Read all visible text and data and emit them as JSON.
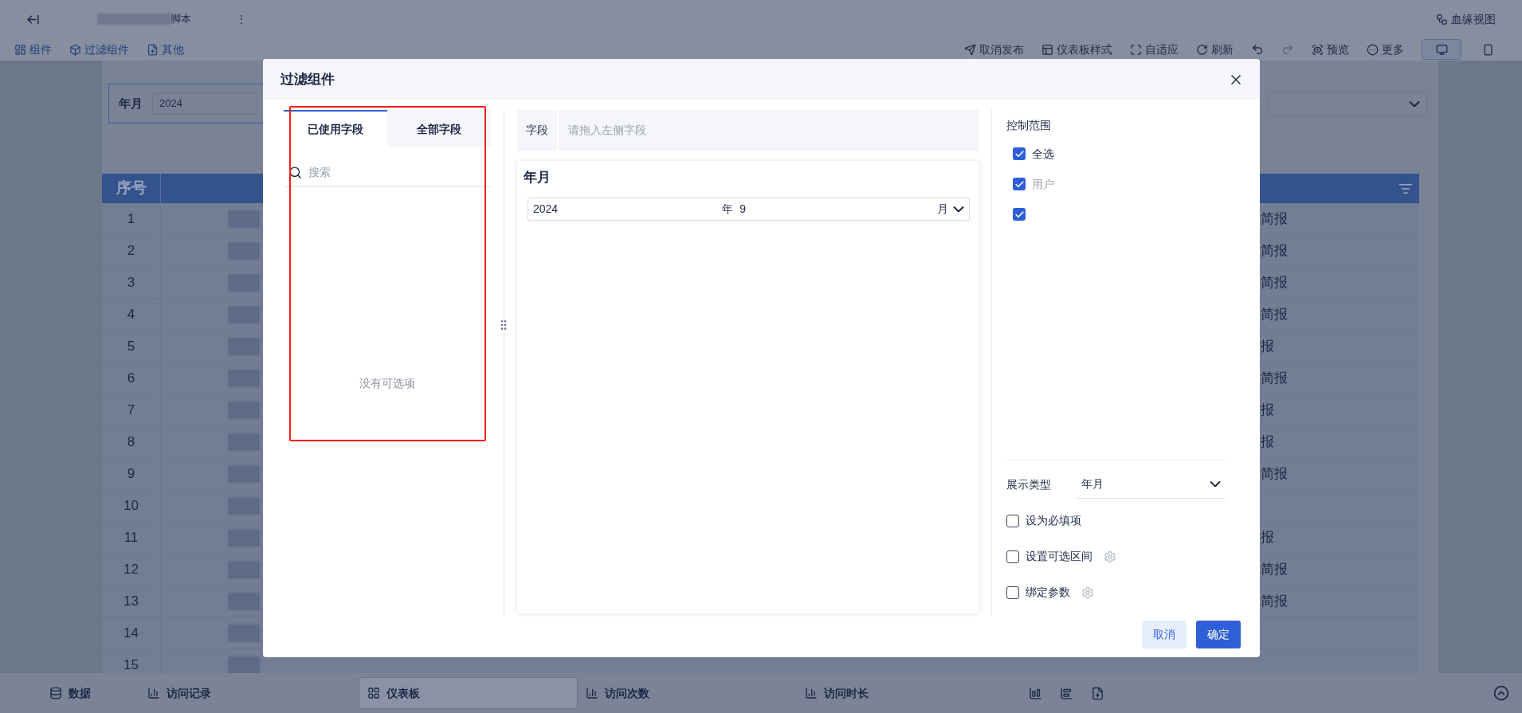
{
  "top_bar": {
    "title_tail": "脚本",
    "more": "⋮",
    "lineage": "血缘视图"
  },
  "toolbar": {
    "left": [
      {
        "kind": "component",
        "label": "组件"
      },
      {
        "kind": "filter",
        "label": "过滤组件"
      },
      {
        "kind": "other",
        "label": "其他"
      }
    ],
    "right": [
      {
        "kind": "unpublish",
        "label": "取消发布"
      },
      {
        "kind": "style",
        "label": "仪表板样式"
      },
      {
        "kind": "fit",
        "label": "自适应"
      },
      {
        "kind": "refresh",
        "label": "刷新"
      }
    ],
    "preview": "预览",
    "more": "更多",
    "devices": [
      {
        "kind": "desktop",
        "selected": true
      },
      {
        "kind": "mobile",
        "selected": false
      }
    ]
  },
  "canvas_filter": {
    "label": "年月",
    "value": "2024"
  },
  "table": {
    "columns": [
      "序号"
    ],
    "rows": [
      {
        "index": "1",
        "tail": "简报"
      },
      {
        "index": "2",
        "tail": "简报"
      },
      {
        "index": "3",
        "tail": "简报"
      },
      {
        "index": "4",
        "tail": "简报"
      },
      {
        "index": "5",
        "tail": "报"
      },
      {
        "index": "6",
        "tail": "简报"
      },
      {
        "index": "7",
        "tail": "报"
      },
      {
        "index": "8",
        "tail": "报"
      },
      {
        "index": "9",
        "tail": "简报"
      },
      {
        "index": "10"
      },
      {
        "index": "11",
        "tail": "报"
      },
      {
        "index": "12",
        "tail": "简报"
      },
      {
        "index": "13",
        "tail": "简报"
      },
      {
        "index": "14"
      },
      {
        "index": "15"
      }
    ]
  },
  "bottom_tabs": [
    {
      "kind": "data",
      "label": "数据",
      "selected": false
    },
    {
      "kind": "chart",
      "label": "访问记录",
      "selected": false
    },
    {
      "kind": "dashboard",
      "label": "仪表板",
      "selected": true
    },
    {
      "kind": "chart",
      "label": "访问次数",
      "selected": false
    },
    {
      "kind": "chart",
      "label": "访问时长",
      "selected": false
    }
  ],
  "dialog": {
    "title": "过滤组件",
    "tabs": [
      {
        "label": "已使用字段",
        "selected": true
      },
      {
        "label": "全部字段",
        "selected": false
      }
    ],
    "search_placeholder": "搜索",
    "empty_text": "没有可选项",
    "field_label": "字段",
    "field_placeholder": "请拖入左侧字段",
    "preview": {
      "title": "年月",
      "year": "2024",
      "year_unit": "年",
      "month": "9",
      "month_unit": "月"
    },
    "scope": {
      "title": "控制范围",
      "items": [
        {
          "label": "全选",
          "checked": true,
          "disabled": false
        },
        {
          "label": "用户",
          "checked": true,
          "disabled": true
        },
        {
          "checked": true
        }
      ]
    },
    "display_type": {
      "label": "展示类型",
      "value": "年月"
    },
    "options": [
      {
        "label": "设为必填项",
        "checked": false,
        "settings": false
      },
      {
        "label": "设置可选区间",
        "checked": false,
        "settings": true
      },
      {
        "label": "绑定参数",
        "checked": false,
        "settings": true
      }
    ],
    "buttons": [
      {
        "kind": "secondary",
        "label": "取消"
      },
      {
        "kind": "primary",
        "label": "确定"
      }
    ]
  }
}
